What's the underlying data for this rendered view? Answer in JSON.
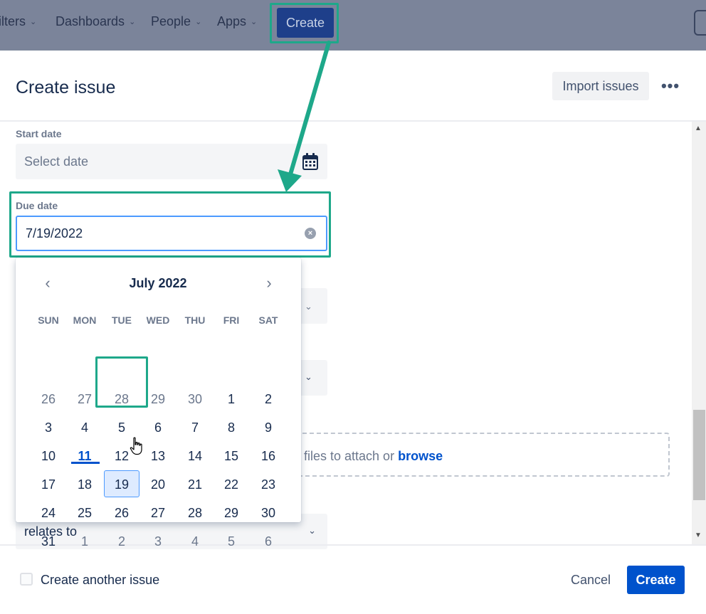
{
  "topnav": {
    "items": [
      {
        "label": "ilters"
      },
      {
        "label": "Dashboards"
      },
      {
        "label": "People"
      },
      {
        "label": "Apps"
      }
    ],
    "create_label": "Create"
  },
  "modal": {
    "title": "Create issue",
    "import_label": "Import issues",
    "more_icon": "more-icon"
  },
  "fields": {
    "start_date": {
      "label": "Start date",
      "placeholder": "Select date"
    },
    "due_date": {
      "label": "Due date",
      "value": "7/19/2022"
    }
  },
  "calendar": {
    "month_label": "July 2022",
    "weekdays": [
      "SUN",
      "MON",
      "TUE",
      "WED",
      "THU",
      "FRI",
      "SAT"
    ],
    "weeks": [
      [
        {
          "d": "26",
          "m": true
        },
        {
          "d": "27",
          "m": true
        },
        {
          "d": "28",
          "m": true
        },
        {
          "d": "29",
          "m": true
        },
        {
          "d": "30",
          "m": true
        },
        {
          "d": "1"
        },
        {
          "d": "2"
        }
      ],
      [
        {
          "d": "3"
        },
        {
          "d": "4"
        },
        {
          "d": "5"
        },
        {
          "d": "6"
        },
        {
          "d": "7"
        },
        {
          "d": "8"
        },
        {
          "d": "9"
        }
      ],
      [
        {
          "d": "10"
        },
        {
          "d": "11",
          "today": true
        },
        {
          "d": "12"
        },
        {
          "d": "13"
        },
        {
          "d": "14"
        },
        {
          "d": "15"
        },
        {
          "d": "16"
        }
      ],
      [
        {
          "d": "17"
        },
        {
          "d": "18"
        },
        {
          "d": "19",
          "selected": true
        },
        {
          "d": "20"
        },
        {
          "d": "21"
        },
        {
          "d": "22"
        },
        {
          "d": "23"
        }
      ],
      [
        {
          "d": "24"
        },
        {
          "d": "25"
        },
        {
          "d": "26"
        },
        {
          "d": "27"
        },
        {
          "d": "28"
        },
        {
          "d": "29"
        },
        {
          "d": "30"
        }
      ],
      [
        {
          "d": "31"
        },
        {
          "d": "1",
          "m": true
        },
        {
          "d": "2",
          "m": true
        },
        {
          "d": "3",
          "m": true
        },
        {
          "d": "4",
          "m": true
        },
        {
          "d": "5",
          "m": true
        },
        {
          "d": "6",
          "m": true
        }
      ]
    ]
  },
  "attachment": {
    "text": "files to attach or ",
    "browse_label": "browse"
  },
  "linked_issue": {
    "value": "relates to"
  },
  "footer": {
    "checkbox_label": "Create another issue",
    "cancel_label": "Cancel",
    "create_label": "Create"
  },
  "colors": {
    "annotation": "#1ea88a",
    "primary": "#0052cc"
  }
}
